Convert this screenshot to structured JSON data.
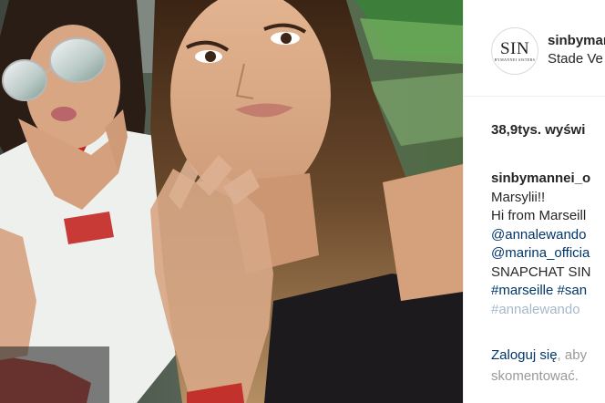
{
  "post": {
    "account": {
      "avatar_logo": "SIN",
      "avatar_subtitle": "BYMANNEI SISTERS",
      "username": "sinbymannei",
      "location": "Stade Ve"
    },
    "views": "38,9tys. wyświ",
    "caption": {
      "author": "sinbymannei_o",
      "lines": [
        "Marsylii!!",
        "Hi from Marseill",
        "@annalewando",
        "@marina_officia",
        "SNAPCHAT SIN",
        "#marseille #san",
        "#annalewando"
      ]
    },
    "login_prompt": {
      "link": "Zaloguj się",
      "rest_line1": ", aby",
      "line2": "skomentować."
    }
  },
  "colors": {
    "link": "#003569",
    "text": "#262626",
    "muted": "#999999",
    "divider": "#efefef"
  }
}
